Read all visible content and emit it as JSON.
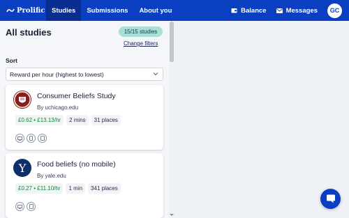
{
  "nav": {
    "logo_text": "Prolific",
    "tabs": [
      {
        "label": "Studies"
      },
      {
        "label": "Submissions"
      },
      {
        "label": "About you"
      }
    ],
    "balance_label": "Balance",
    "messages_label": "Messages",
    "avatar_initials": "GC",
    "brand_color": "#0a3fc2"
  },
  "panel": {
    "title": "All studies",
    "count_pill": "15/15 studies",
    "change_filters": "Change filters",
    "sort_label": "Sort",
    "sort_value": "Reward per hour (highest to lowest)"
  },
  "studies": [
    {
      "title": "Consumer Beliefs Study",
      "by": "By uchicago.edu",
      "reward": "£0.62 • £13.13/hr",
      "duration": "2 mins",
      "places": "31 places",
      "logo": "uchicago-crest-icon",
      "devices": [
        "desktop-icon",
        "mobile-icon",
        "tablet-icon"
      ]
    },
    {
      "title": "Food beliefs (no mobile)",
      "by": "By yale.edu",
      "reward": "£0.27 • £11.10/hr",
      "duration": "1 min",
      "places": "341 places",
      "logo": "yale-y-icon",
      "devices": [
        "desktop-icon",
        "tablet-icon"
      ]
    }
  ]
}
